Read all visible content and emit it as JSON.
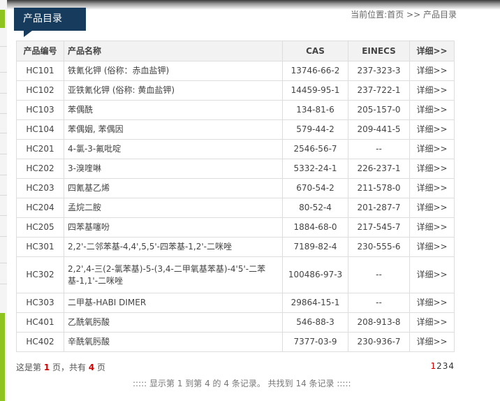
{
  "header": {
    "section_title": "产品目录",
    "breadcrumb_prefix": "当前位置:",
    "breadcrumb_home": "首页",
    "breadcrumb_sep": " >> ",
    "breadcrumb_current": "产品目录"
  },
  "table": {
    "headers": {
      "code": "产品编号",
      "name": "产品名称",
      "cas": "CAS",
      "einecs": "EINECS",
      "detail": "详细>>"
    },
    "rows": [
      {
        "code": "HC101",
        "name": "铁氰化钾 (俗称：赤血盐钾)",
        "cas": "13746-66-2",
        "einecs": "237-323-3",
        "detail": "详细>>"
      },
      {
        "code": "HC102",
        "name": "亚铁氰化钾 (俗称: 黄血盐钾)",
        "cas": "14459-95-1",
        "einecs": "237-722-1",
        "detail": "详细>>"
      },
      {
        "code": "HC103",
        "name": "苯偶酰",
        "cas": "134-81-6",
        "einecs": "205-157-0",
        "detail": "详细>>"
      },
      {
        "code": "HC104",
        "name": "苯偶姻, 苯偶因",
        "cas": "579-44-2",
        "einecs": "209-441-5",
        "detail": "详细>>"
      },
      {
        "code": "HC201",
        "name": "4-氯-3-氟吡啶",
        "cas": "2546-56-7",
        "einecs": "--",
        "detail": "详细>>"
      },
      {
        "code": "HC202",
        "name": "3-溴喹啉",
        "cas": "5332-24-1",
        "einecs": "226-237-1",
        "detail": "详细>>"
      },
      {
        "code": "HC203",
        "name": "四氰基乙烯",
        "cas": "670-54-2",
        "einecs": "211-578-0",
        "detail": "详细>>"
      },
      {
        "code": "HC204",
        "name": "孟烷二胺",
        "cas": "80-52-4",
        "einecs": "201-287-7",
        "detail": "详细>>"
      },
      {
        "code": "HC205",
        "name": "四苯基噻吩",
        "cas": "1884-68-0",
        "einecs": "217-545-7",
        "detail": "详细>>"
      },
      {
        "code": "HC301",
        "name": "2,2'-二邻苯基-4,4',5,5'-四苯基-1,2'-二咪唑",
        "cas": "7189-82-4",
        "einecs": "230-555-6",
        "detail": "详细>>"
      },
      {
        "code": "HC302",
        "name": "2,2',4-三(2-氯苯基)-5-(3,4-二甲氧基苯基)-4'5'-二苯基-1,1'-二咪唑",
        "cas": "100486-97-3",
        "einecs": "--",
        "detail": "详细>>"
      },
      {
        "code": "HC303",
        "name": "二甲基-HABI DIMER",
        "cas": "29864-15-1",
        "einecs": "--",
        "detail": "详细>>"
      },
      {
        "code": "HC401",
        "name": "乙酰氧肟酸",
        "cas": "546-88-3",
        "einecs": "208-913-8",
        "detail": "详细>>"
      },
      {
        "code": "HC402",
        "name": "辛酰氧肟酸",
        "cas": "7377-03-9",
        "einecs": "230-936-7",
        "detail": "详细>>"
      }
    ]
  },
  "pager": {
    "text1": "这是第 ",
    "current_page": "1",
    "text2": " 页，共有 ",
    "total_pages": "4",
    "text3": " 页",
    "pages": [
      "1",
      "2",
      "3",
      "4"
    ],
    "summary": "::::: 显示第 1 到第 4 的 4 条记录。 共找到 14 条记录 :::::"
  },
  "colors": {
    "title_bg": "#163b5c",
    "accent_green": "#8fc31f",
    "page_red": "#cc0000"
  }
}
